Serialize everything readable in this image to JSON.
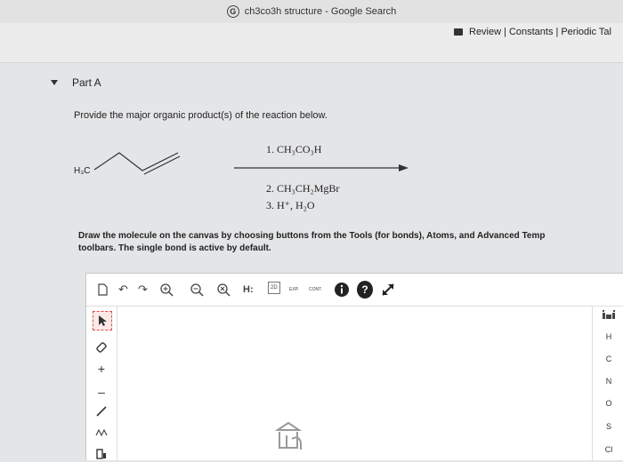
{
  "window": {
    "title": "ch3co3h structure - Google Search"
  },
  "topbar": {
    "review": "Review",
    "constants": "Constants",
    "periodic": "Periodic Tal",
    "sep": "|"
  },
  "part": {
    "label": "Part A"
  },
  "question": {
    "text": "Provide the major organic product(s) of the reaction below."
  },
  "reaction": {
    "reactant_label": "H₃C",
    "step1": "1.  CH₃CO₃H",
    "step2": "2.  CH₃CH₂MgBr",
    "step3": "3.  H⁺, H₂O"
  },
  "instructions": {
    "line1": "Draw the molecule on the canvas by choosing buttons from the Tools (for bonds), Atoms, and Advanced Temp",
    "line2": "toolbars. The single bond is active by default."
  },
  "toolbar": {
    "h_label": "H:",
    "twod": "2D",
    "exp": "EXP.",
    "cont": "CONT.",
    "help": "?"
  },
  "atoms": [
    "H",
    "C",
    "N",
    "O",
    "S",
    "Cl"
  ],
  "colors": {
    "background": "#e4e5e7",
    "panel": "#ffffff",
    "select": "#d9534f"
  }
}
